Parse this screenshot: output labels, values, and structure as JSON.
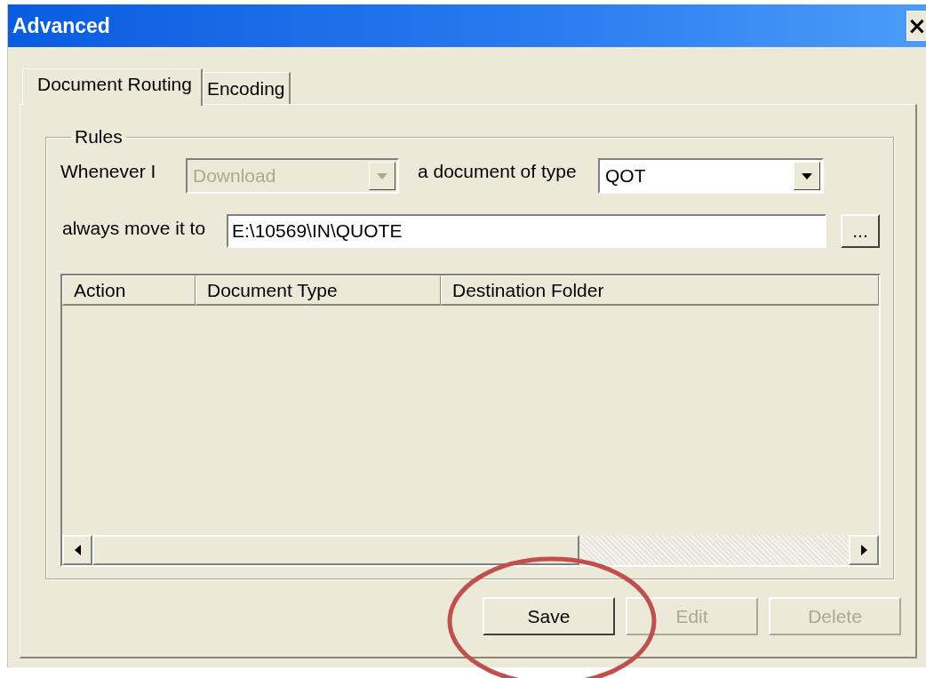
{
  "window": {
    "title": "Advanced",
    "close": "×"
  },
  "tabs": [
    {
      "label": "Document Routing",
      "selected": true
    },
    {
      "label": "Encoding",
      "selected": false
    }
  ],
  "rules": {
    "title": "Rules",
    "whenever_label": "Whenever I",
    "action": {
      "value": "Download",
      "disabled": true
    },
    "type_label": "a document of type",
    "document_type": {
      "value": "QOT",
      "disabled": false
    },
    "move_label": "always move it to",
    "destination": "E:\\10569\\IN\\QUOTE",
    "browse": "..."
  },
  "table": {
    "columns": [
      "Action",
      "Document Type",
      "Destination Folder"
    ]
  },
  "buttons": [
    {
      "label": "Save",
      "disabled": false
    },
    {
      "label": "Edit",
      "disabled": true
    },
    {
      "label": "Delete",
      "disabled": true
    }
  ]
}
